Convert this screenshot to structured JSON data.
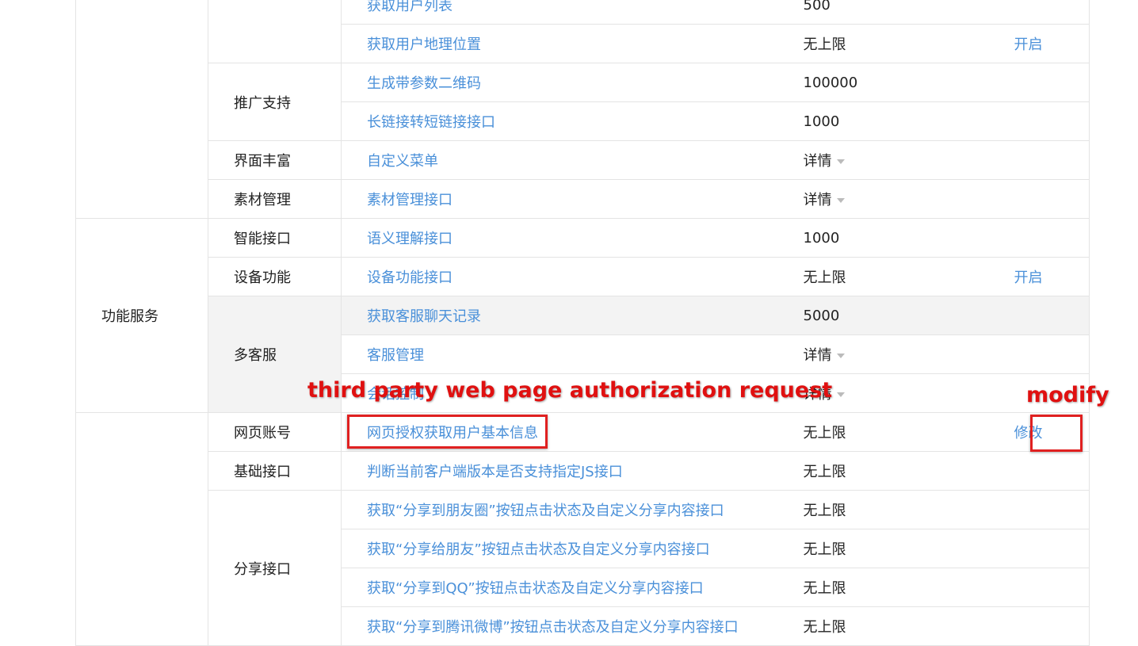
{
  "rows": {
    "r0": {
      "api": "获取用户列表",
      "quota": "500"
    },
    "r1": {
      "api": "获取用户地理位置",
      "quota": "无上限",
      "op": "开启"
    },
    "r2": {
      "sub": "推广支持",
      "api": "生成带参数二维码",
      "quota": "100000"
    },
    "r3": {
      "api": "长链接转短链接接口",
      "quota": "1000"
    },
    "r4": {
      "sub": "界面丰富",
      "api": "自定义菜单",
      "quota": "详情"
    },
    "r5": {
      "sub": "素材管理",
      "api": "素材管理接口",
      "quota": "详情"
    },
    "r6": {
      "cat": "功能服务",
      "sub": "智能接口",
      "api": "语义理解接口",
      "quota": "1000"
    },
    "r7": {
      "sub": "设备功能",
      "api": "设备功能接口",
      "quota": "无上限",
      "op": "开启"
    },
    "r8": {
      "sub": "多客服",
      "api": "获取客服聊天记录",
      "quota": "5000"
    },
    "r9": {
      "api": "客服管理",
      "quota": "详情"
    },
    "r10": {
      "api": "会话控制",
      "quota": "详情"
    },
    "r11": {
      "sub": "网页账号",
      "api": "网页授权获取用户基本信息",
      "quota": "无上限",
      "op": "修改"
    },
    "r12": {
      "sub": "基础接口",
      "api": "判断当前客户端版本是否支持指定JS接口",
      "quota": "无上限"
    },
    "r13": {
      "sub": "分享接口",
      "api": "获取“分享到朋友圈”按钮点击状态及自定义分享内容接口",
      "quota": "无上限"
    },
    "r14": {
      "api": "获取“分享给朋友”按钮点击状态及自定义分享内容接口",
      "quota": "无上限"
    },
    "r15": {
      "api": "获取“分享到QQ”按钮点击状态及自定义分享内容接口",
      "quota": "无上限"
    },
    "r16": {
      "api": "获取“分享到腾讯微博”按钮点击状态及自定义分享内容接口",
      "quota": "无上限"
    }
  },
  "annotations": {
    "third_party": "third party web page authorization request",
    "modify": "modify"
  },
  "colors": {
    "link": "#4a90d9",
    "highlight": "#e02020",
    "row_hover": "#f3f3f3"
  }
}
